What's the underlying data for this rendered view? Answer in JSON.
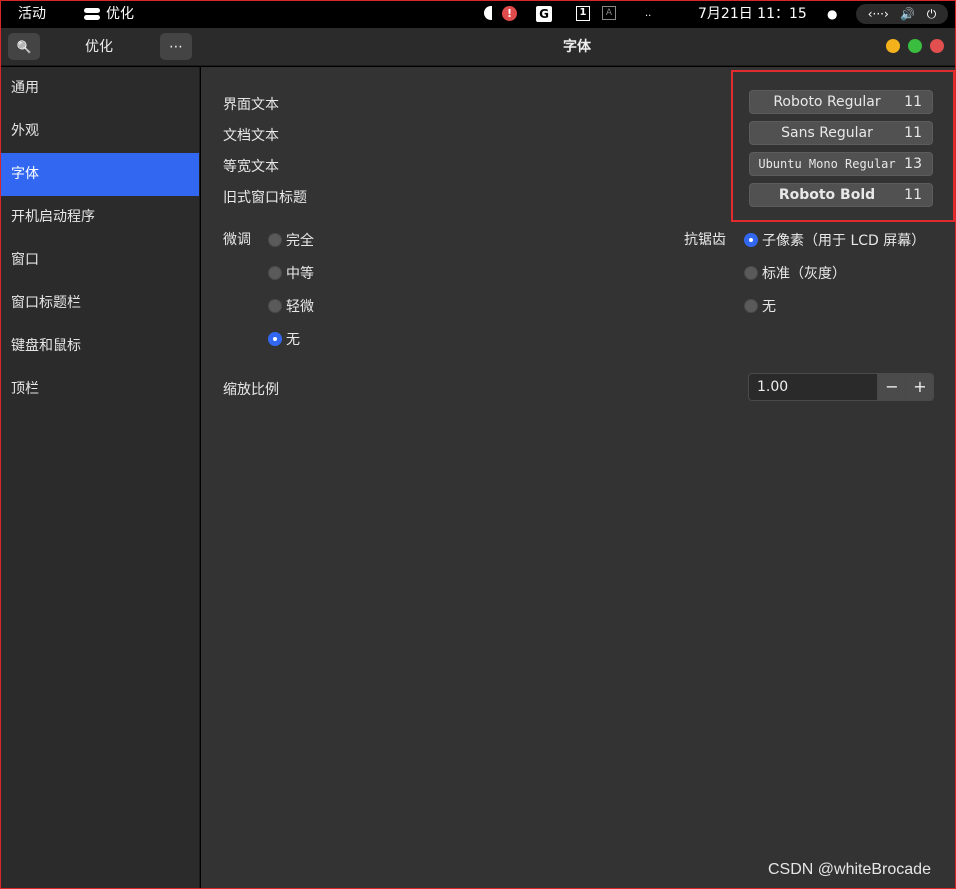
{
  "topbar": {
    "activities": "活动",
    "app_name": "优化",
    "alert_glyph": "!",
    "g_glyph": "G",
    "one_glyph": "1",
    "a_glyph": "A",
    "dots": "..",
    "clock": "7月21日  11：15",
    "dot": "●",
    "network_glyph": "‹···›",
    "volume_glyph": "🔊",
    "power_glyph": "⏻"
  },
  "header": {
    "search_glyph": "🔍",
    "app_title": "优化",
    "menu_glyph": "⋯",
    "title": "字体"
  },
  "sidebar": {
    "items": [
      {
        "label": "通用"
      },
      {
        "label": "外观"
      },
      {
        "label": "字体"
      },
      {
        "label": "开机启动程序"
      },
      {
        "label": "窗口"
      },
      {
        "label": "窗口标题栏"
      },
      {
        "label": "键盘和鼠标"
      },
      {
        "label": "顶栏"
      }
    ],
    "active_index": 2
  },
  "fonts": {
    "interface_label": "界面文本",
    "document_label": "文档文本",
    "monospace_label": "等宽文本",
    "legacy_title_label": "旧式窗口标题",
    "interface_font": "Roboto Regular",
    "interface_size": "11",
    "document_font": "Sans Regular",
    "document_size": "11",
    "monospace_font": "Ubuntu Mono Regular",
    "monospace_size": "13",
    "legacy_title_font": "Roboto Bold",
    "legacy_title_size": "11"
  },
  "hinting": {
    "label": "微调",
    "options": [
      "完全",
      "中等",
      "轻微",
      "无"
    ],
    "selected": "无"
  },
  "antialiasing": {
    "label": "抗锯齿",
    "options": [
      "子像素（用于 LCD 屏幕）",
      "标准（灰度）",
      "无"
    ],
    "selected": "子像素（用于 LCD 屏幕）"
  },
  "scaling": {
    "label": "缩放比例",
    "value": "1.00",
    "minus": "−",
    "plus": "+"
  },
  "watermark": "CSDN @whiteBrocade",
  "colors": {
    "accent": "#3268f1",
    "highlight_box": "#e02b2f"
  }
}
